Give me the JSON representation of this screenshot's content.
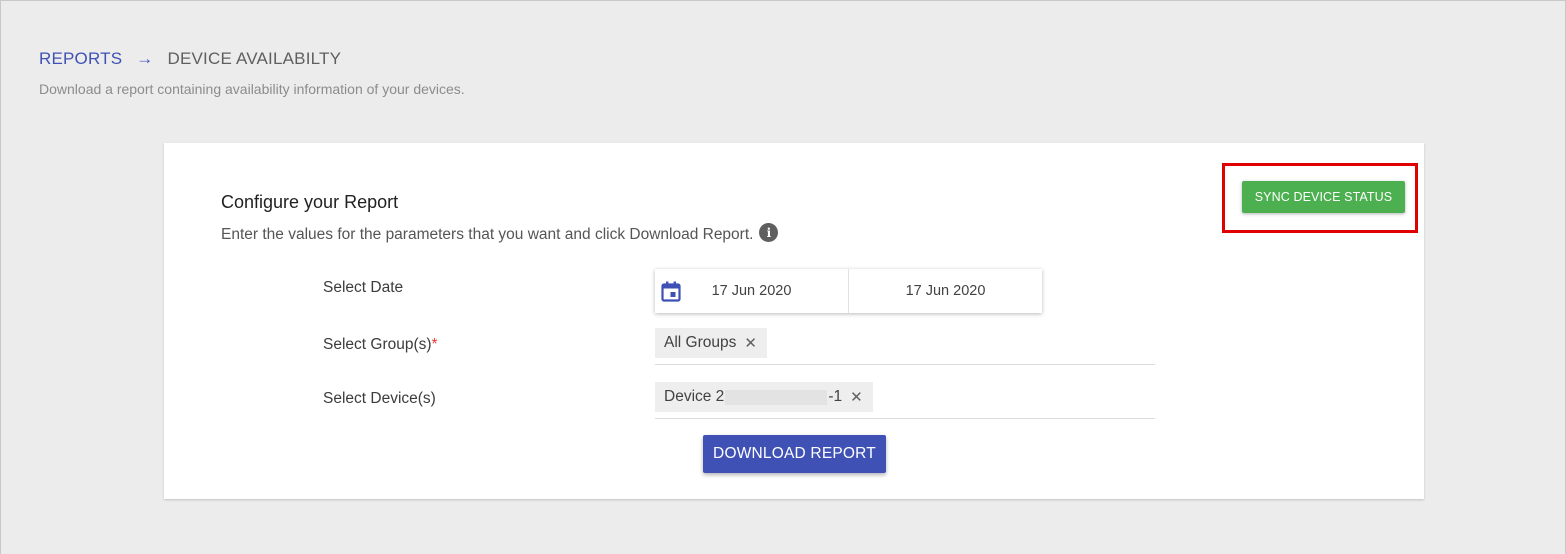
{
  "breadcrumb": {
    "root": "REPORTS",
    "arrow": "→",
    "current": "DEVICE AVAILABILTY"
  },
  "subtitle": "Download a report containing availability information of your devices.",
  "card": {
    "title": "Configure your Report",
    "description": "Enter the values for the parameters that you want and click Download Report.",
    "info_icon": "info-icon"
  },
  "form": {
    "date_label": "Select Date",
    "date_start": "17 Jun 2020",
    "date_end": "17 Jun 2020",
    "calendar_icon": "calendar-icon",
    "group_label": "Select Group(s)",
    "group_required_mark": "*",
    "group_chip": "All Groups",
    "device_label": "Select Device(s)",
    "device_chip_prefix": "Device 2",
    "device_chip_suffix": "-1",
    "chip_remove": "✕"
  },
  "actions": {
    "download_label": "DOWNLOAD REPORT",
    "sync_label": "SYNC DEVICE STATUS"
  },
  "colors": {
    "primary": "#3f51b5",
    "success": "#4caf50",
    "highlight": "#e00000",
    "required": "#e53935"
  }
}
